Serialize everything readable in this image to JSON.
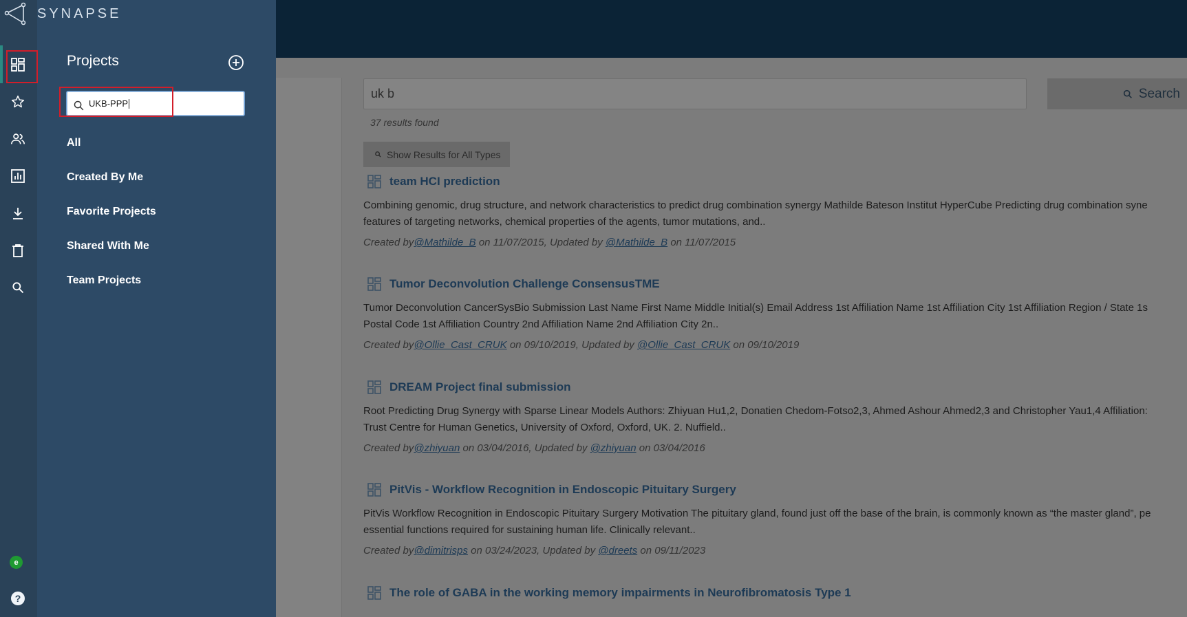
{
  "app": {
    "logo_text": "SYNAPSE"
  },
  "search": {
    "query": "uk b",
    "button_label": "Search",
    "results_count": "37 results found",
    "show_all_label": "Show Results for All Types"
  },
  "results": [
    {
      "title": "team HCI prediction",
      "desc_line1": "Combining genomic, drug structure, and network characteristics to predict drug combination synergy Mathilde Bateson Institut HyperCube Predicting drug combination syne",
      "desc_line2": "features of targeting networks, chemical properties of the agents, tumor mutations, and..",
      "created_prefix": "Created by",
      "creator": "@Mathilde_B",
      "created_on": "on 11/07/2015, Updated by",
      "updater": "@Mathilde_B",
      "updated_on": "on 11/07/2015"
    },
    {
      "title": "Tumor Deconvolution Challenge ConsensusTME",
      "desc_line1": "Tumor Deconvolution CancerSysBio Submission Last Name First Name Middle Initial(s) Email Address 1st Affiliation Name 1st Affiliation City 1st Affiliation Region / State 1s",
      "desc_line2": "Postal Code 1st Affiliation Country 2nd Affiliation Name 2nd Affiliation City 2n..",
      "created_prefix": "Created by",
      "creator": "@Ollie_Cast_CRUK",
      "created_on": "on 09/10/2019, Updated by",
      "updater": "@Ollie_Cast_CRUK",
      "updated_on": "on 09/10/2019"
    },
    {
      "title": "DREAM Project final submission",
      "desc_line1": "Root Predicting Drug Synergy with Sparse Linear Models Authors: Zhiyuan Hu1,2, Donatien Chedom-Fotso2,3, Ahmed Ashour Ahmed2,3 and Christopher Yau1,4 Affiliation:",
      "desc_line2": "Trust Centre for Human Genetics, University of Oxford, Oxford, UK. 2. Nuffield..",
      "created_prefix": "Created by",
      "creator": "@zhiyuan",
      "created_on": "on 03/04/2016, Updated by",
      "updater": "@zhiyuan",
      "updated_on": "on 03/04/2016"
    },
    {
      "title": "PitVis - Workflow Recognition in Endoscopic Pituitary Surgery",
      "desc_line1": "PitVis Workflow Recognition in Endoscopic Pituitary Surgery Motivation The pituitary gland, found just off the base of the brain, is commonly known as “the master gland”, pe",
      "desc_line2": "essential functions required for sustaining human life. Clinically relevant..",
      "created_prefix": "Created by",
      "creator": "@dimitrisps",
      "created_on": "on 03/24/2023, Updated by",
      "updater": "@dreets",
      "updated_on": "on 09/11/2023"
    },
    {
      "title": "The role of GABA in the working memory impairments in Neurofibromatosis Type 1"
    }
  ],
  "drawer": {
    "title": "Projects",
    "filter_value": "UKB-PPP",
    "items": [
      {
        "label": "All"
      },
      {
        "label": "Created By Me"
      },
      {
        "label": "Favorite Projects"
      },
      {
        "label": "Shared With Me"
      },
      {
        "label": "Team Projects"
      }
    ]
  },
  "rail": {
    "icons": [
      "projects-icon",
      "favorites-star-icon",
      "teams-icon",
      "challenges-chart-icon",
      "downloads-icon",
      "trash-icon",
      "search-icon"
    ]
  },
  "user": {
    "avatar_letter": "e"
  },
  "help": {
    "label": "?"
  },
  "colors": {
    "rail": "#2a4258",
    "drawer": "#2d4a66",
    "highlight": "#d21e2a",
    "active_bar": "#2b8a83"
  }
}
